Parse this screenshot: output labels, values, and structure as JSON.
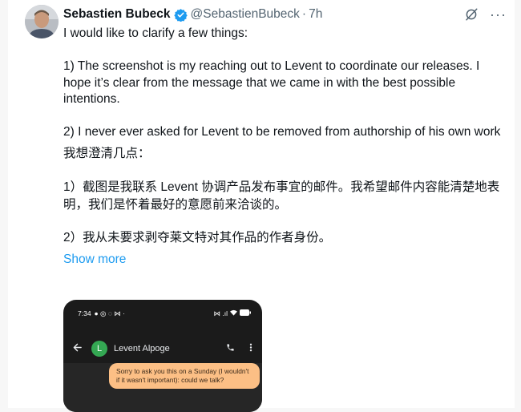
{
  "author": {
    "name": "Sebastien Bubeck",
    "handle": "@SebastienBubeck",
    "separator": "·",
    "time": "7h",
    "verified": true
  },
  "header_actions": {
    "grok_icon": "grok-slash-icon",
    "more_icon": "more-horizontal-icon"
  },
  "tweet": {
    "intro": "I would like to clarify a few things:",
    "point1": "1) The screenshot is my reaching out to Levent to coordinate our releases. I hope it’s clear from the message that we came in with the best possible intentions.",
    "point2": "2) I never ever asked for Levent to be removed from authorship of his own work",
    "zh_intro": "我想澄清几点：",
    "zh_point1": "1）截图是我联系 Levent 协调产品发布事宜的邮件。我希望邮件内容能清楚地表明，我们是怀着最好的意愿前来洽谈的。",
    "zh_point2": "2）我从未要求剥夺莱文特对其作品的作者身份。",
    "show_more": "Show more"
  },
  "screenshot": {
    "status_time": "7:34",
    "contact_initial": "L",
    "contact_name": "Levent Alpoge",
    "message": "Sorry to ask you this on a Sunday (I wouldn't if it wasn't important): could we talk?"
  },
  "colors": {
    "link": "#1d9bf0",
    "verified_badge": "#1d9bf0",
    "secondary_text": "#536471",
    "message_bubble": "#fcbf85",
    "contact_avatar": "#34a853"
  }
}
